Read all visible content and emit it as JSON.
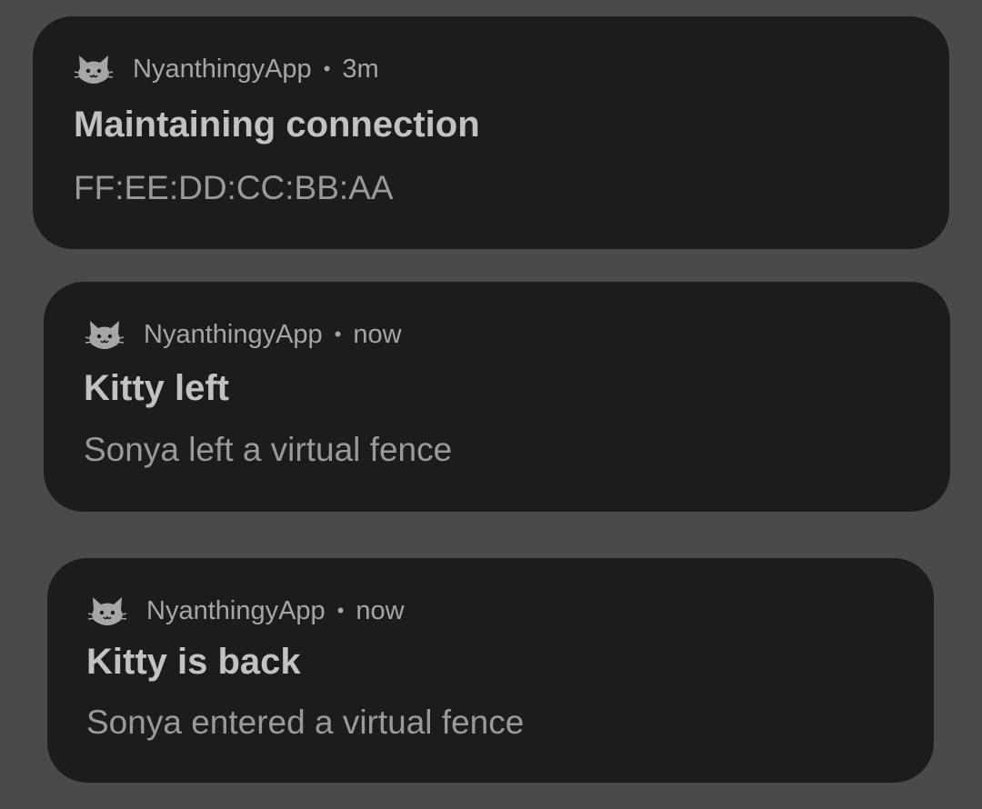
{
  "notifications": [
    {
      "app_name": "NyanthingyApp",
      "separator": "•",
      "time": "3m",
      "icon": "cat-face-icon",
      "title": "Maintaining connection",
      "body": "FF:EE:DD:CC:BB:AA"
    },
    {
      "app_name": "NyanthingyApp",
      "separator": "•",
      "time": "now",
      "icon": "cat-face-icon",
      "title": "Kitty left",
      "body": "Sonya left a virtual fence"
    },
    {
      "app_name": "NyanthingyApp",
      "separator": "•",
      "time": "now",
      "icon": "cat-face-icon",
      "title": "Kitty is back",
      "body": "Sonya entered a virtual fence"
    }
  ],
  "colors": {
    "background": "#4a4a4a",
    "card": "#1c1c1c",
    "title_text": "#c2c2c2",
    "secondary_text": "#a6a6a6"
  }
}
